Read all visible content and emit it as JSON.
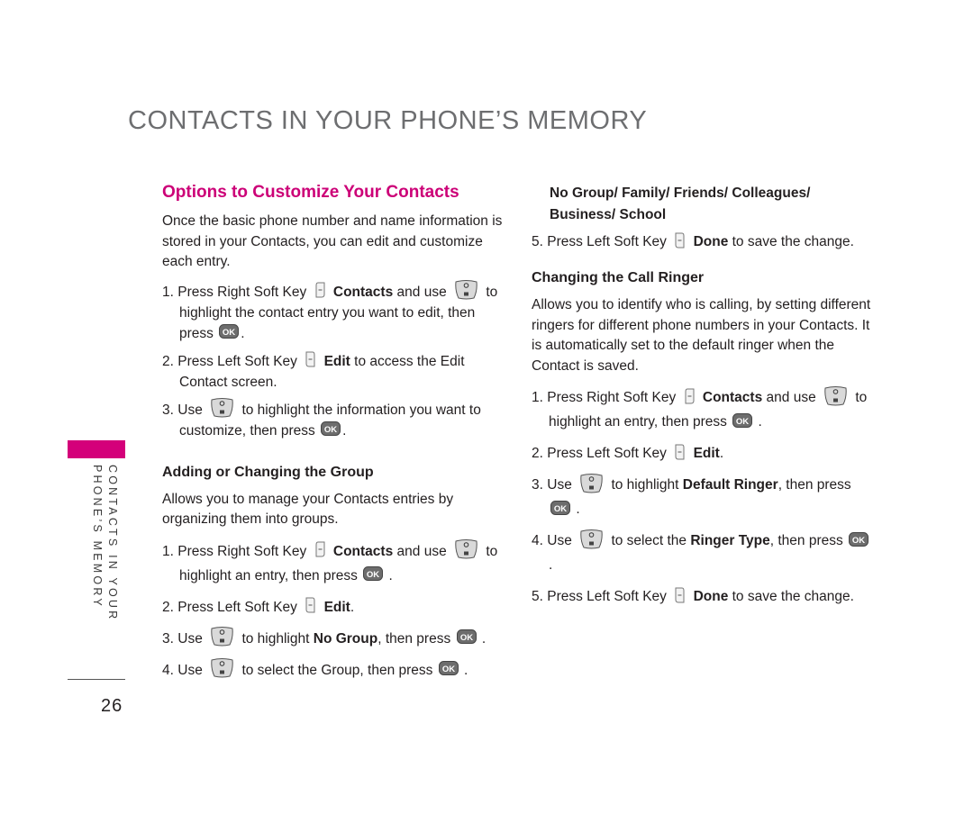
{
  "page": {
    "title": "CONTACTS IN YOUR PHONE’S MEMORY",
    "side_tab": {
      "line1": "CONTACTS IN YOUR",
      "line2": "PHONE’S MEMORY"
    },
    "page_number": "26",
    "accent_color": "#d4007a"
  },
  "left": {
    "heading": "Options to Customize Your Contacts",
    "intro": "Once the basic phone number and name information is stored in your Contacts, you can edit and customize each entry.",
    "steps": [
      {
        "num": "1.",
        "a": "Press Right Soft Key",
        "b": "Contacts",
        "c": "and use",
        "d": "to highlight the contact entry you want to edit, then press",
        "e": "."
      },
      {
        "num": "2.",
        "a": "Press Left Soft Key",
        "b": "Edit",
        "c": "to access the Edit Contact screen."
      },
      {
        "num": "3.",
        "a": "Use",
        "b": "to highlight the information you want to customize, then press",
        "c": "."
      }
    ],
    "group_heading": "Adding or Changing the Group",
    "group_intro": "Allows you to manage your Contacts entries by organizing them into groups.",
    "group_steps": [
      {
        "num": "1.",
        "a": "Press Right Soft Key",
        "b": "Contacts",
        "c": "and use",
        "d": "to highlight an entry, then press",
        "e": "."
      },
      {
        "num": "2.",
        "a": "Press Left Soft Key",
        "b": "Edit",
        "c": "."
      },
      {
        "num": "3.",
        "a": "Use",
        "b": "to highlight",
        "c": "No Group",
        "d": ", then press",
        "e": "."
      },
      {
        "num": "4.",
        "a": "Use",
        "b": "to select the Group, then press",
        "c": "."
      }
    ]
  },
  "right": {
    "group_options": "No Group/ Family/ Friends/ Colleagues/ Business/ School",
    "group_step5": {
      "num": "5.",
      "a": "Press Left Soft Key",
      "b": "Done",
      "c": "to save the change."
    },
    "ringer_heading": "Changing the Call Ringer",
    "ringer_intro": "Allows you to identify who is calling, by setting different ringers for different phone numbers in your Contacts. It is automatically set to the default ringer when the Contact is saved.",
    "ringer_steps": [
      {
        "num": "1.",
        "a": "Press Right Soft Key",
        "b": "Contacts",
        "c": "and use",
        "d": "to highlight an entry, then press",
        "e": "."
      },
      {
        "num": "2.",
        "a": "Press Left Soft Key",
        "b": "Edit",
        "c": "."
      },
      {
        "num": "3.",
        "a": "Use",
        "b": "to highlight",
        "c": "Default Ringer",
        "d": ", then press",
        "e": "."
      },
      {
        "num": "4.",
        "a": "Use",
        "b": "to select the",
        "c": "Ringer Type",
        "d": ", then press",
        "e": "."
      },
      {
        "num": "5.",
        "a": "Press Left Soft Key",
        "b": "Done",
        "c": "to save the change."
      }
    ]
  },
  "icons": {
    "right_soft_key": "right-soft-key-icon",
    "left_soft_key": "left-soft-key-icon",
    "nav_key": "navigation-key-icon",
    "ok_key": "ok-key-icon",
    "ok_label": "OK"
  }
}
